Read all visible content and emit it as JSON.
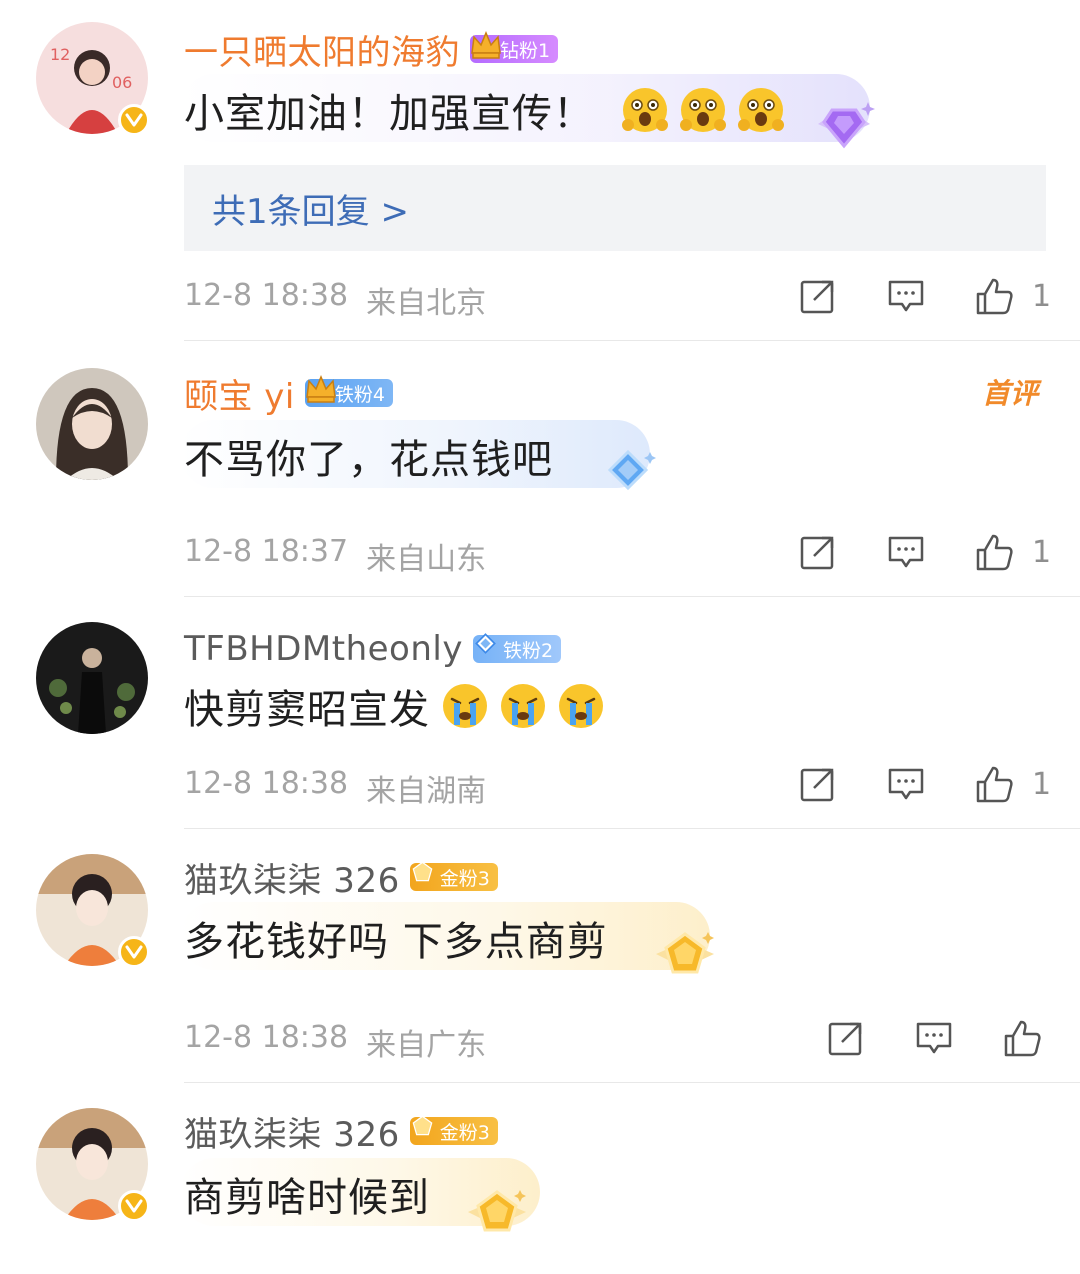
{
  "comments": [
    {
      "username": "一只晒太阳的海豹",
      "badge": "钻粉1",
      "text": "小室加油！加强宣传！",
      "time": "12-8 18:38",
      "location": "来自北京",
      "likes": "1",
      "replies_label": "共1条回复 >"
    },
    {
      "username": "颐宝 yi",
      "badge": "铁粉4",
      "text": "不骂你了，花点钱吧",
      "time": "12-8 18:37",
      "location": "来自山东",
      "likes": "1",
      "tag": "首评"
    },
    {
      "username": "TFBHDMtheonly",
      "badge": "铁粉2",
      "text": "快剪窦昭宣发",
      "time": "12-8 18:38",
      "location": "来自湖南",
      "likes": "1"
    },
    {
      "username": "猫玖柒柒 326",
      "badge": "金粉3",
      "text": "多花钱好吗 下多点商剪",
      "time": "12-8 18:38",
      "location": "来自广东",
      "likes": ""
    },
    {
      "username": "猫玖柒柒 326",
      "badge": "金粉3",
      "text": "商剪啥时候到"
    }
  ],
  "icons": {
    "share": "share-icon",
    "comment": "comment-icon",
    "like": "thumbs-up-icon",
    "verified": "verified-v-icon",
    "emoji_grin": "grinning-emoji-icon",
    "emoji_cry": "crying-emoji-icon"
  },
  "colors": {
    "username_highlight": "#ef7b2f",
    "reply_link": "#3e6cb6",
    "meta_text": "#a4a4a4",
    "verified_badge": "#f6b518"
  }
}
